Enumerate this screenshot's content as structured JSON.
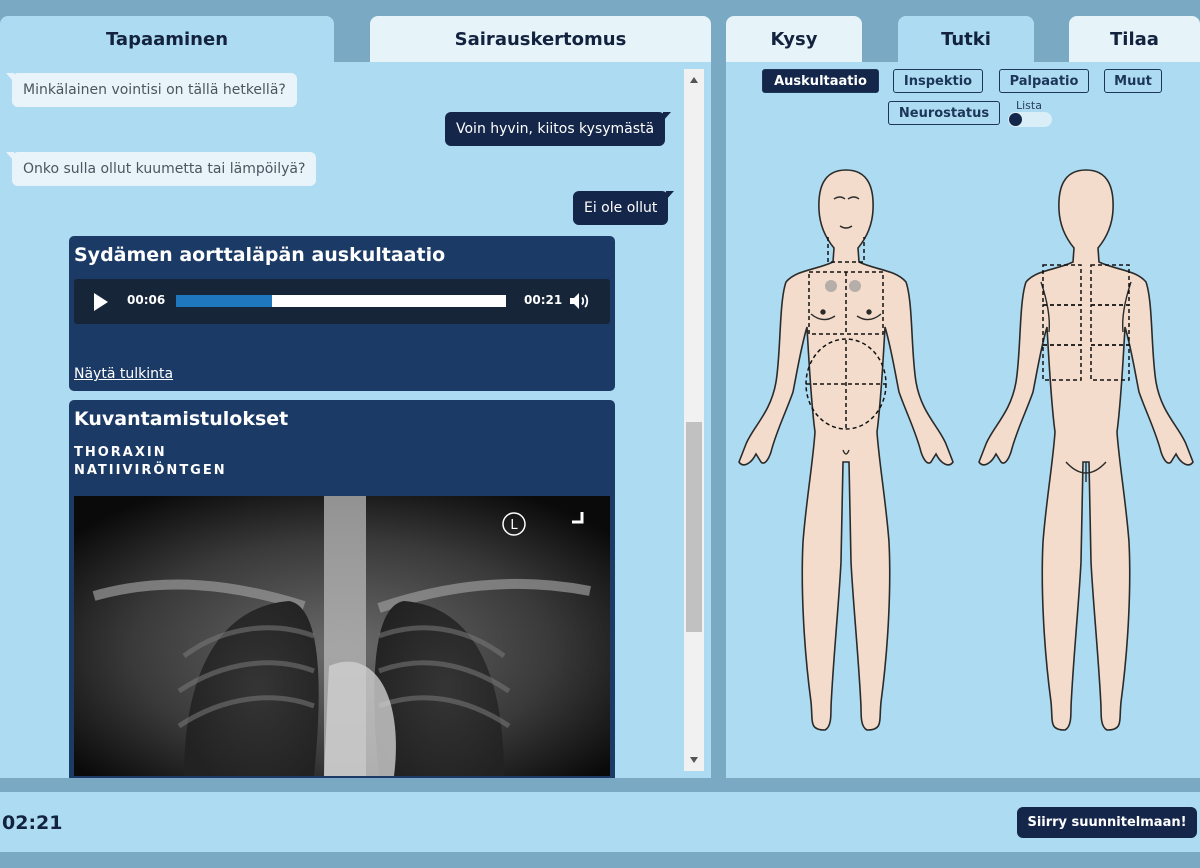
{
  "left_tabs": [
    {
      "label": "Tapaaminen",
      "active": true
    },
    {
      "label": "Sairauskertomus",
      "active": false
    }
  ],
  "chat": {
    "messages": [
      {
        "from": "doctor",
        "text": "Minkälainen vointisi on tällä hetkellä?"
      },
      {
        "from": "patient",
        "text": "Voin hyvin, kiitos kysymästä"
      },
      {
        "from": "doctor",
        "text": "Onko sulla ollut kuumetta tai lämpöilyä?"
      },
      {
        "from": "patient",
        "text": "Ei ole ollut"
      }
    ]
  },
  "auscultation_card": {
    "title": "Sydämen aorttaläpän auskultaatio",
    "current_time": "00:06",
    "duration": "00:21",
    "progress": 0.29,
    "link": "Näytä tulkinta"
  },
  "imaging_card": {
    "title": "Kuvantamistulokset",
    "subtitle_line1": "THORAXIN",
    "subtitle_line2": "NATIIVIRÖNTGEN",
    "marker": "L"
  },
  "right_tabs": [
    {
      "label": "Kysy",
      "active": false
    },
    {
      "label": "Tutki",
      "active": true
    },
    {
      "label": "Tilaa",
      "active": false
    }
  ],
  "exam_types": [
    {
      "label": "Auskultaatio",
      "active": true
    },
    {
      "label": "Inspektio",
      "active": false
    },
    {
      "label": "Palpaatio",
      "active": false
    },
    {
      "label": "Muut",
      "active": false
    },
    {
      "label": "Neurostatus",
      "active": false
    }
  ],
  "list_toggle": {
    "label": "Lista",
    "on": false
  },
  "footer": {
    "timer": "02:21",
    "next_button": "Siirry suunnitelmaan!"
  },
  "colors": {
    "panel_bg": "#addcf2",
    "frame_bg": "#7aa9c4",
    "navy": "#14264a",
    "card_bg": "#1c3a66",
    "skin": "#f3dccb"
  }
}
